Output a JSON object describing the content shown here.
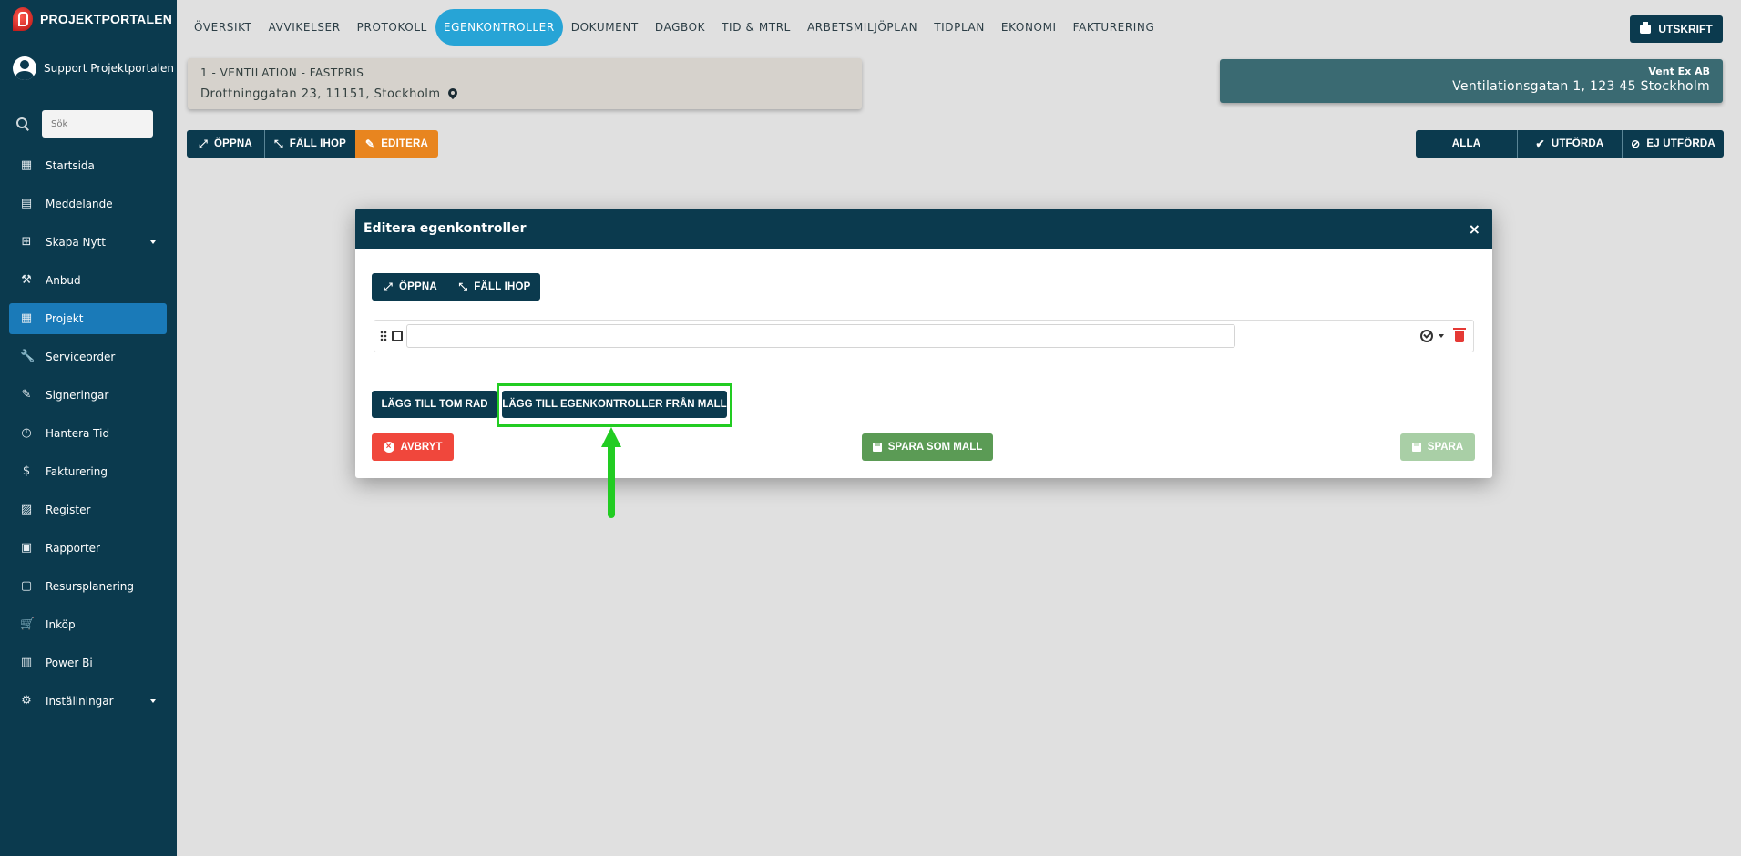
{
  "app": {
    "brand": "PROJEKTPORTALEN",
    "user": "Support Projektportalen"
  },
  "sidebar": {
    "search_placeholder": "Sök",
    "items": [
      {
        "label": "Startsida",
        "icon": "dashboard-icon"
      },
      {
        "label": "Meddelande",
        "icon": "message-icon"
      },
      {
        "label": "Skapa Nytt",
        "icon": "plus-box-icon",
        "caret": true
      },
      {
        "label": "Anbud",
        "icon": "gavel-icon"
      },
      {
        "label": "Projekt",
        "icon": "project-icon",
        "active": true
      },
      {
        "label": "Serviceorder",
        "icon": "wrench-icon"
      },
      {
        "label": "Signeringar",
        "icon": "pen-icon"
      },
      {
        "label": "Hantera Tid",
        "icon": "clock-icon"
      },
      {
        "label": "Fakturering",
        "icon": "dollar-icon"
      },
      {
        "label": "Register",
        "icon": "image-icon"
      },
      {
        "label": "Rapporter",
        "icon": "calendar-icon"
      },
      {
        "label": "Resursplanering",
        "icon": "calendar-blank-icon"
      },
      {
        "label": "Inköp",
        "icon": "cart-icon"
      },
      {
        "label": "Power Bi",
        "icon": "chart-icon"
      },
      {
        "label": "Inställningar",
        "icon": "gear-icon",
        "caret": true
      }
    ]
  },
  "topnav": {
    "tabs": [
      "ÖVERSIKT",
      "AVVIKELSER",
      "PROTOKOLL",
      "EGENKONTROLLER",
      "DOKUMENT",
      "DAGBOK",
      "TID & MTRL",
      "ARBETSMILJÖPLAN",
      "TIDPLAN",
      "EKONOMI",
      "FAKTURERING"
    ],
    "active_tab": "EGENKONTROLLER",
    "print_label": "UTSKRIFT"
  },
  "project": {
    "title": "1 - VENTILATION - FASTPRIS",
    "address": "Drottninggatan 23, 11151, Stockholm"
  },
  "company": {
    "name": "Vent Ex AB",
    "address": "Ventilationsgatan 1, 123 45 Stockholm"
  },
  "actions": {
    "open": "ÖPPNA",
    "collapse": "FÄLL IHOP",
    "edit": "EDITERA"
  },
  "filters": {
    "all": "ALLA",
    "done": "UTFÖRDA",
    "not_done": "EJ UTFÖRDA"
  },
  "modal": {
    "title": "Editera egenkontroller",
    "close": "×",
    "open": "ÖPPNA",
    "collapse": "FÄLL IHOP",
    "row_value": "",
    "add_empty_row": "LÄGG TILL TOM RAD",
    "add_from_template": "LÄGG TILL EGENKONTROLLER FRÅN MALL",
    "cancel": "AVBRYT",
    "save_as_template": "SPARA SOM MALL",
    "save": "SPARA"
  },
  "colors": {
    "sidebar": "#0b3a4e",
    "active_tab": "#27a4d6",
    "highlight": "#22cc22",
    "edit": "#e8851f",
    "cancel": "#f0473c",
    "save_template": "#5b9b55"
  }
}
